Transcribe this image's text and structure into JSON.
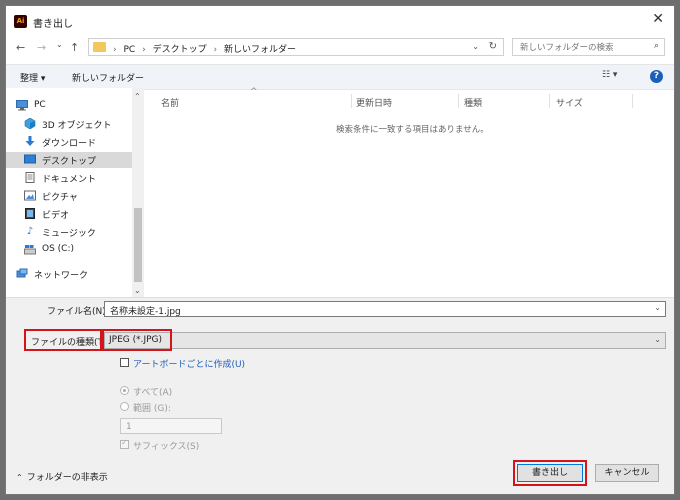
{
  "window": {
    "title": "書き出し",
    "app_icon_text": "Ai",
    "close_glyph": "✕"
  },
  "nav": {
    "back": "←",
    "forward": "→",
    "recent": "⌄",
    "up": "↑",
    "breadcrumbs": [
      "PC",
      "デスクトップ",
      "新しいフォルダー"
    ],
    "breadcrumb_sep": "›",
    "search_placeholder": "新しいフォルダーの検索"
  },
  "toolbar": {
    "organize": "整理 ▾",
    "new_folder": "新しいフォルダー",
    "view": "☷ ▾",
    "help": "?"
  },
  "sidebar": {
    "items": [
      {
        "label": "PC",
        "icon": "pc-icon"
      },
      {
        "label": "3D オブジェクト",
        "icon": "3d-objects-icon"
      },
      {
        "label": "ダウンロード",
        "icon": "download-icon"
      },
      {
        "label": "デスクトップ",
        "icon": "desktop-icon"
      },
      {
        "label": "ドキュメント",
        "icon": "document-icon"
      },
      {
        "label": "ピクチャ",
        "icon": "pictures-icon"
      },
      {
        "label": "ビデオ",
        "icon": "video-icon"
      },
      {
        "label": "ミュージック",
        "icon": "music-icon"
      },
      {
        "label": "OS (C:)",
        "icon": "drive-icon"
      },
      {
        "label": "ネットワーク",
        "icon": "network-icon"
      }
    ],
    "selected": "デスクトップ"
  },
  "filelist": {
    "columns": [
      "名前",
      "更新日時",
      "種類",
      "サイズ"
    ],
    "empty_message": "検索条件に一致する項目はありません。"
  },
  "form": {
    "filename_label": "ファイル名(N):",
    "filename_value": "名称未設定-1.jpg",
    "filetype_label": "ファイルの種類(T):",
    "filetype_value": "JPEG (*.JPG)",
    "artboard_option": "アートボードごとに作成(U)",
    "all_option": "すべて(A)",
    "range_option": "範囲 (G):",
    "range_value": "1",
    "suffix_option": "サフィックス(S)",
    "hide_folders": "フォルダーの非表示",
    "save_button": "書き出し",
    "cancel_button": "キャンセル"
  },
  "colors": {
    "highlight": "#d4141b",
    "accent": "#0078d7",
    "help": "#1c5fb8"
  }
}
